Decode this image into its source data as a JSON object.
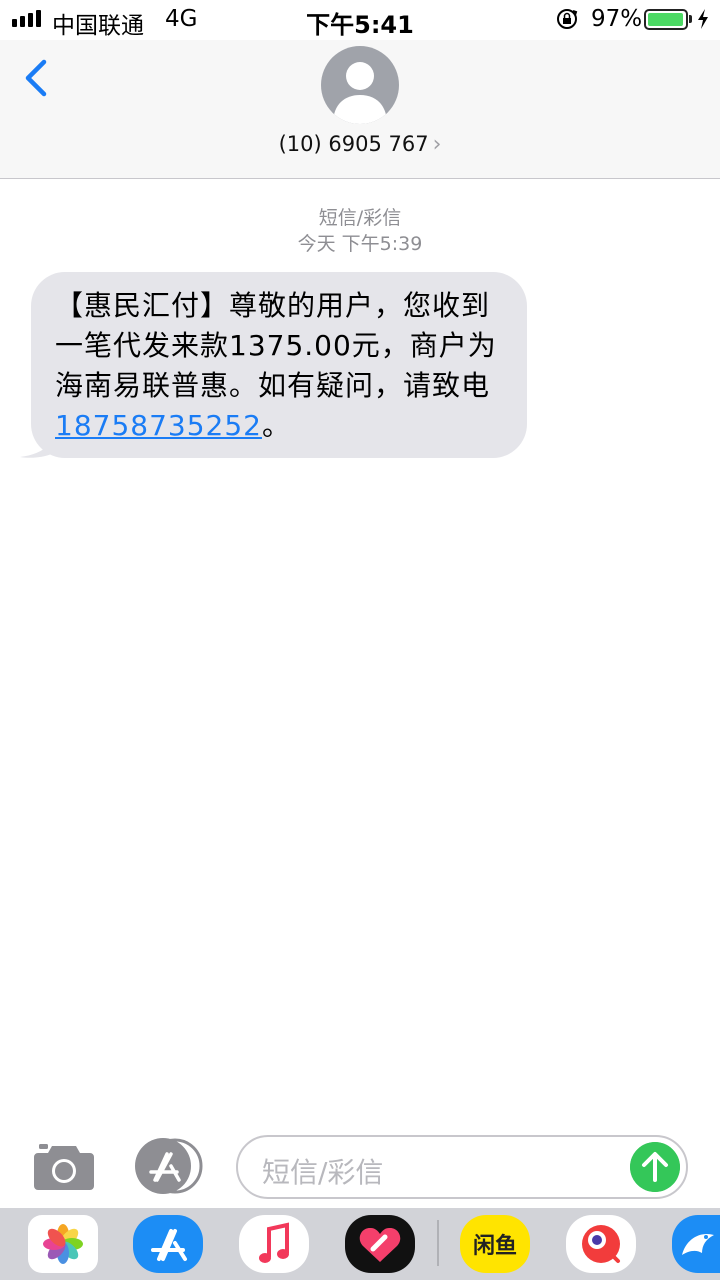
{
  "status_bar": {
    "carrier": "中国联通",
    "network": "4G",
    "time": "下午5:41",
    "battery_percent": "97%",
    "battery_level": 0.97,
    "icons": [
      "signal-icon",
      "orientation-lock-icon",
      "battery-icon",
      "charging-bolt-icon"
    ]
  },
  "header": {
    "contact": "(10) 6905 767",
    "chevron": "›",
    "icons": [
      "back-chevron-icon",
      "default-avatar-icon"
    ]
  },
  "conversation": {
    "message_type": "短信/彩信",
    "timestamp": "今天 下午5:39",
    "messages": [
      {
        "direction": "incoming",
        "text_before": "【惠民汇付】尊敬的用户，您收到一笔代发来款1375.00元，商户为海南易联普惠。如有疑问，请致电",
        "phone_link": "18758735252",
        "text_after": "。"
      }
    ]
  },
  "compose": {
    "placeholder": "短信/彩信",
    "icons": [
      "camera-icon",
      "app-store-icon",
      "send-arrow-icon"
    ]
  },
  "app_drawer": {
    "apps": [
      "photos-app-icon",
      "app-store-app-icon",
      "music-app-icon",
      "heart-app-icon",
      "xianyu-app-icon",
      "red-fish-app-icon",
      "blue-bird-app-icon"
    ],
    "xianyu_label": "闲鱼"
  },
  "colors": {
    "accent": "#1a7cf5",
    "bubble_incoming": "#e5e5ea",
    "send_button": "#34c759",
    "battery": "#4cd964"
  }
}
